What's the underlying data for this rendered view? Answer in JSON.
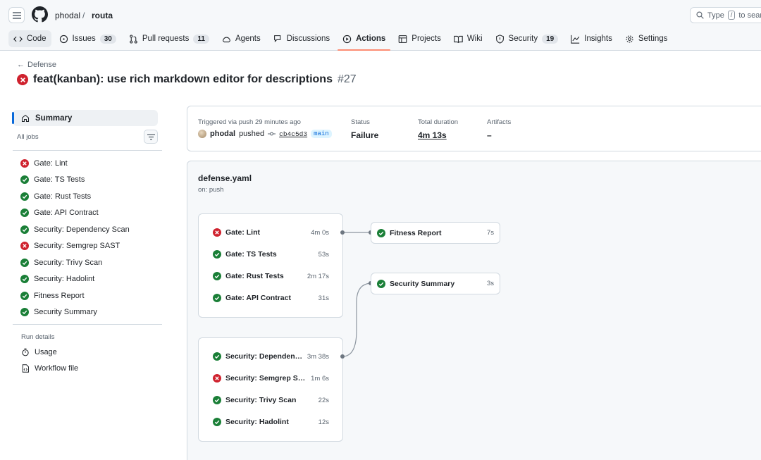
{
  "repo": {
    "owner": "phodal",
    "separator": "/",
    "name": "routa"
  },
  "search": {
    "prefix": "Type",
    "key": "/",
    "suffix": "to search"
  },
  "nav": [
    {
      "label": "Code",
      "icon": "code-icon"
    },
    {
      "label": "Issues",
      "count": "30",
      "icon": "issue-icon"
    },
    {
      "label": "Pull requests",
      "count": "11",
      "icon": "pull-request-icon"
    },
    {
      "label": "Agents",
      "icon": "agents-icon"
    },
    {
      "label": "Discussions",
      "icon": "discussions-icon"
    },
    {
      "label": "Actions",
      "icon": "play-icon",
      "active": true
    },
    {
      "label": "Projects",
      "icon": "table-icon"
    },
    {
      "label": "Wiki",
      "icon": "book-icon"
    },
    {
      "label": "Security",
      "count": "19",
      "icon": "shield-icon"
    },
    {
      "label": "Insights",
      "icon": "graph-icon"
    },
    {
      "label": "Settings",
      "icon": "gear-icon"
    }
  ],
  "run": {
    "back_label": "Defense",
    "title": "feat(kanban): use rich markdown editor for descriptions",
    "number": "#27",
    "status_icon": "x-circle-fill-icon"
  },
  "sidebar": {
    "summary_label": "Summary",
    "all_jobs_label": "All jobs",
    "jobs": [
      {
        "label": "Gate: Lint",
        "status": "failure"
      },
      {
        "label": "Gate: TS Tests",
        "status": "success"
      },
      {
        "label": "Gate: Rust Tests",
        "status": "success"
      },
      {
        "label": "Gate: API Contract",
        "status": "success"
      },
      {
        "label": "Security: Dependency Scan",
        "status": "success"
      },
      {
        "label": "Security: Semgrep SAST",
        "status": "failure"
      },
      {
        "label": "Security: Trivy Scan",
        "status": "success"
      },
      {
        "label": "Security: Hadolint",
        "status": "success"
      },
      {
        "label": "Fitness Report",
        "status": "success"
      },
      {
        "label": "Security Summary",
        "status": "success"
      }
    ],
    "run_details_label": "Run details",
    "usage_label": "Usage",
    "workflow_file_label": "Workflow file"
  },
  "summary": {
    "trigger_label": "Triggered via push 29 minutes ago",
    "actor": "phodal",
    "action": "pushed",
    "commit": "cb4c5d3",
    "branch": "main",
    "status_label": "Status",
    "status_value": "Failure",
    "duration_label": "Total duration",
    "duration_value": "4m 13s",
    "artifacts_label": "Artifacts",
    "artifacts_value": "–"
  },
  "workflow": {
    "file": "defense.yaml",
    "trigger": "on: push",
    "gate_group": [
      {
        "name": "Gate: Lint",
        "duration": "4m 0s",
        "status": "failure"
      },
      {
        "name": "Gate: TS Tests",
        "duration": "53s",
        "status": "success"
      },
      {
        "name": "Gate: Rust Tests",
        "duration": "2m 17s",
        "status": "success"
      },
      {
        "name": "Gate: API Contract",
        "duration": "31s",
        "status": "success"
      }
    ],
    "security_group": [
      {
        "name": "Security: Dependency ...",
        "duration": "3m 38s",
        "status": "success"
      },
      {
        "name": "Security: Semgrep SAST",
        "duration": "1m 6s",
        "status": "failure"
      },
      {
        "name": "Security: Trivy Scan",
        "duration": "22s",
        "status": "success"
      },
      {
        "name": "Security: Hadolint",
        "duration": "12s",
        "status": "success"
      }
    ],
    "fitness": {
      "name": "Fitness Report",
      "duration": "7s",
      "status": "success"
    },
    "security_summary": {
      "name": "Security Summary",
      "duration": "3s",
      "status": "success"
    }
  },
  "colors": {
    "success": "#1a7f37",
    "failure": "#cf222e",
    "accent": "#0969da",
    "active_underline": "#fd8c73"
  }
}
